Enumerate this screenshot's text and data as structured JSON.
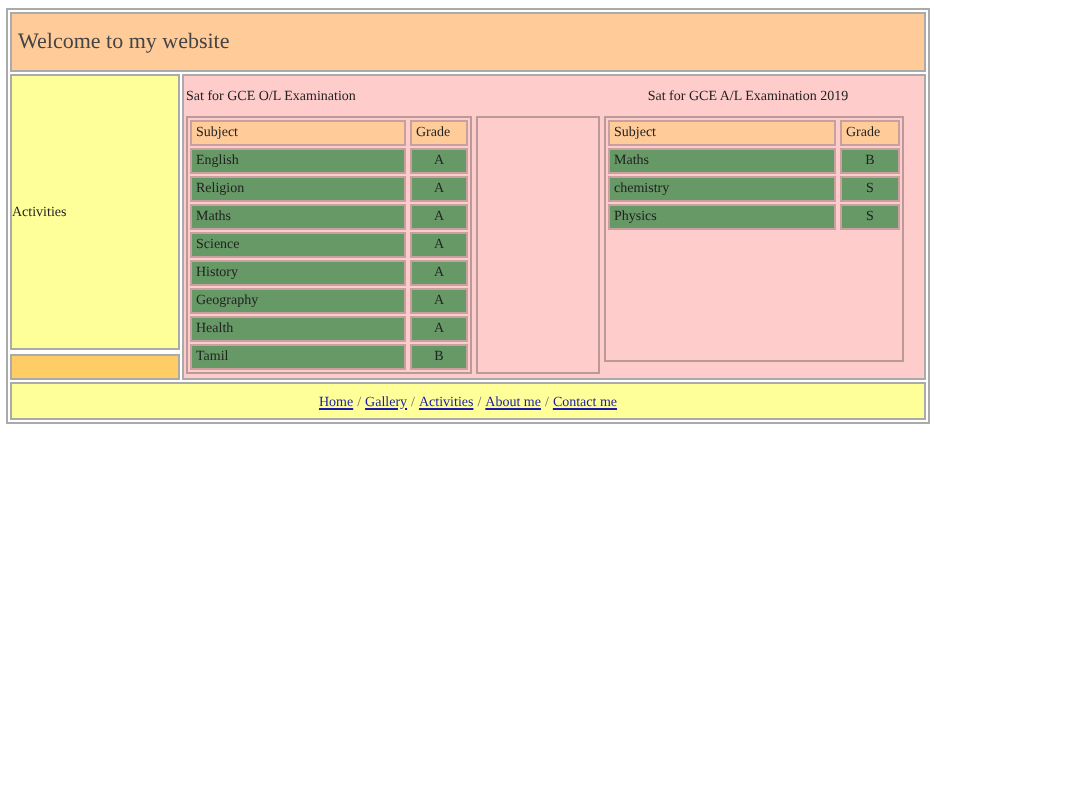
{
  "header": {
    "title": "Welcome to my website"
  },
  "sidebar": {
    "label": "Activities"
  },
  "ol": {
    "title": "Sat for GCE O/L Examination",
    "columns": [
      "Subject",
      "Grade"
    ],
    "rows": [
      [
        "English",
        "A"
      ],
      [
        "Religion",
        "A"
      ],
      [
        "Maths",
        "A"
      ],
      [
        "Science",
        "A"
      ],
      [
        "History",
        "A"
      ],
      [
        "Geography",
        "A"
      ],
      [
        "Health",
        "A"
      ],
      [
        "Tamil",
        "B"
      ]
    ]
  },
  "al": {
    "title": "Sat for GCE A/L Examination 2019",
    "columns": [
      "Subject",
      "Grade"
    ],
    "rows": [
      [
        "Maths",
        "B"
      ],
      [
        "chemistry",
        "S"
      ],
      [
        "Physics",
        "S"
      ]
    ]
  },
  "footer": {
    "separator": "/",
    "links": [
      "Home",
      "Gallery",
      "Activities",
      "About me",
      "Contact me"
    ]
  }
}
